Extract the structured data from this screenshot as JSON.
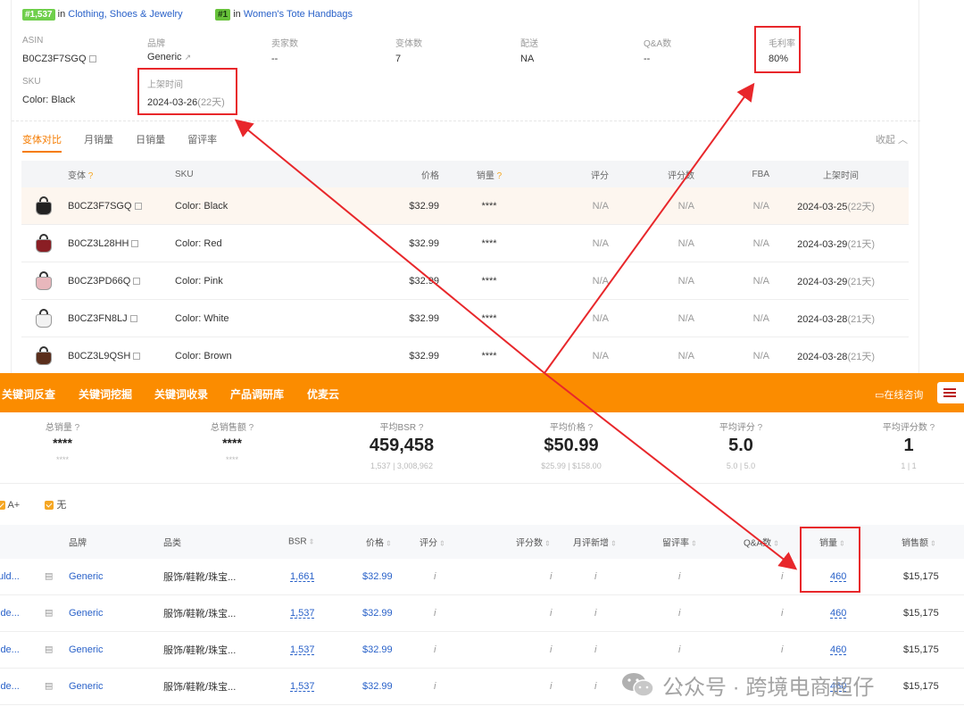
{
  "header": {
    "rank1": "#1,537",
    "rank1_in": "in",
    "rank1_cat": "Clothing, Shoes & Jewelry",
    "rank2": "#1",
    "rank2_in": "in",
    "rank2_cat": "Women's Tote Handbags"
  },
  "info": {
    "asin_label": "ASIN",
    "asin_value": "B0CZ3F7SGQ",
    "brand_label": "品牌",
    "brand_value": "Generic",
    "variant_count_label": "卖家数",
    "variant_count_value": "--",
    "variants_label": "变体数",
    "variants_value": "7",
    "delivery_label": "配送",
    "delivery_value": "NA",
    "qa_label": "Q&A数",
    "qa_value": "--",
    "margin_label": "毛利率",
    "margin_value": "80%",
    "sku_label": "SKU",
    "sku_value": "Color: Black",
    "listed_label": "上架时间",
    "listed_value": "2024-03-26",
    "listed_days": "(22天)"
  },
  "tabs": [
    "变体对比",
    "月销量",
    "日销量",
    "留评率"
  ],
  "collapse": "收起",
  "variant_table": {
    "headers": [
      "变体",
      "SKU",
      "价格",
      "销量",
      "评分",
      "评分数",
      "FBA",
      "上架时间"
    ],
    "rows": [
      {
        "asin": "B0CZ3F7SGQ",
        "sku": "Color: Black",
        "price": "$32.99",
        "sales": "****",
        "rating": "N/A",
        "ratings": "N/A",
        "fba": "N/A",
        "date": "2024-03-25",
        "days": "(22天)",
        "color": "#222222"
      },
      {
        "asin": "B0CZ3L28HH",
        "sku": "Color: Red",
        "price": "$32.99",
        "sales": "****",
        "rating": "N/A",
        "ratings": "N/A",
        "fba": "N/A",
        "date": "2024-03-29",
        "days": "(21天)",
        "color": "#8a1e24"
      },
      {
        "asin": "B0CZ3PD66Q",
        "sku": "Color: Pink",
        "price": "$32.99",
        "sales": "****",
        "rating": "N/A",
        "ratings": "N/A",
        "fba": "N/A",
        "date": "2024-03-29",
        "days": "(21天)",
        "color": "#e8b7bc"
      },
      {
        "asin": "B0CZ3FN8LJ",
        "sku": "Color: White",
        "price": "$32.99",
        "sales": "****",
        "rating": "N/A",
        "ratings": "N/A",
        "fba": "N/A",
        "date": "2024-03-28",
        "days": "(21天)",
        "color": "#f2f2f2"
      },
      {
        "asin": "B0CZ3L9QSH",
        "sku": "Color: Brown",
        "price": "$32.99",
        "sales": "****",
        "rating": "N/A",
        "ratings": "N/A",
        "fba": "N/A",
        "date": "2024-03-28",
        "days": "(21天)",
        "color": "#5a2e1c"
      }
    ]
  },
  "orange_nav": {
    "items": [
      "关键词反查",
      "关键词挖掘",
      "关键词收录",
      "产品调研库",
      "优麦云"
    ],
    "consult": "在线咨询"
  },
  "stats": [
    {
      "label": "总销量",
      "value": "****",
      "sub": "****"
    },
    {
      "label": "总销售额",
      "value": "****",
      "sub": "****"
    },
    {
      "label": "平均BSR",
      "value": "459,458",
      "sub": "1,537 | 3,008,962"
    },
    {
      "label": "平均价格",
      "value": "$50.99",
      "sub": "$25.99 | $158.00"
    },
    {
      "label": "平均评分",
      "value": "5.0",
      "sub": "5.0 | 5.0"
    },
    {
      "label": "平均评分数",
      "value": "1",
      "sub": "1 | 1"
    }
  ],
  "filters": {
    "aplus": "A+",
    "none": "无"
  },
  "product_table": {
    "headers": [
      "品牌",
      "品类",
      "BSR",
      "价格",
      "评分",
      "评分数",
      "月评新增",
      "留评率",
      "Q&A数",
      "销量",
      "销售额"
    ],
    "rows": [
      {
        "name": "uld...",
        "brand": "Generic",
        "cat": "服饰/鞋靴/珠宝...",
        "bsr": "1,661",
        "price": "$32.99",
        "sales": "460",
        "revenue": "$15,175"
      },
      {
        "name": "lde...",
        "brand": "Generic",
        "cat": "服饰/鞋靴/珠宝...",
        "bsr": "1,537",
        "price": "$32.99",
        "sales": "460",
        "revenue": "$15,175"
      },
      {
        "name": "lde...",
        "brand": "Generic",
        "cat": "服饰/鞋靴/珠宝...",
        "bsr": "1,537",
        "price": "$32.99",
        "sales": "460",
        "revenue": "$15,175"
      },
      {
        "name": "lde...",
        "brand": "Generic",
        "cat": "服饰/鞋靴/珠宝...",
        "bsr": "1,537",
        "price": "$32.99",
        "sales": "460",
        "revenue": "$15,175"
      }
    ]
  },
  "watermark": "公众号 · 跨境电商超仔"
}
